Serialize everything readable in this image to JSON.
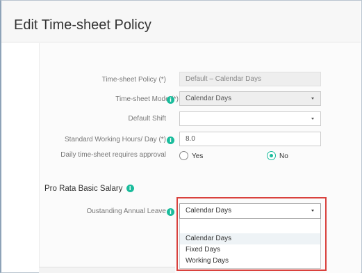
{
  "page": {
    "title": "Edit Time-sheet Policy"
  },
  "form": {
    "timesheet_policy": {
      "label": "Time-sheet Policy (*)",
      "value": "Default – Calendar Days"
    },
    "timesheet_mode": {
      "label": "Time-sheet Mode (*)",
      "value": "Calendar Days"
    },
    "default_shift": {
      "label": "Default Shift",
      "value": ""
    },
    "standard_hours": {
      "label": "Standard Working Hours/ Day (*)",
      "value": "8.0"
    },
    "daily_approval": {
      "label": "Daily time-sheet requires approval",
      "options": [
        "Yes",
        "No"
      ],
      "selected": "No"
    }
  },
  "pro_rata": {
    "section_title": "Pro Rata Basic Salary",
    "outstanding_leave": {
      "label": "Oustanding Annual Leave",
      "value": "Calendar Days",
      "options": [
        "Calendar Days",
        "Fixed Days",
        "Working Days"
      ],
      "highlighted": "Calendar Days"
    }
  },
  "icons": {
    "info": "info-icon",
    "caret": "chevron-down-icon"
  },
  "colors": {
    "accent": "#1abc9c",
    "highlight_border": "#d9413d"
  }
}
